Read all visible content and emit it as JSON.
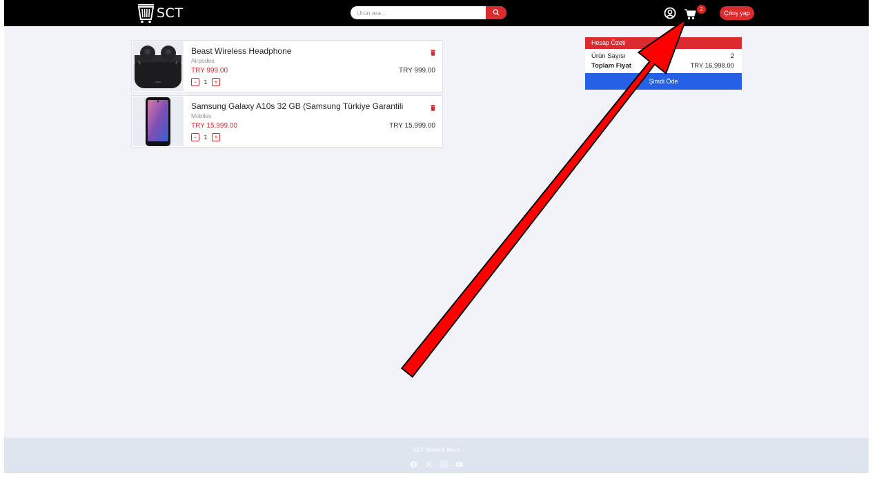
{
  "header": {
    "brand": "SCT",
    "search_placeholder": "Ürün ara...",
    "cart_count": "2",
    "logout_label": "Çıkış yap",
    "icons": {
      "logo": "basket-logo-icon",
      "search": "search-icon",
      "account": "user-circle-icon",
      "cart": "cart-icon"
    }
  },
  "cart": {
    "items": [
      {
        "title": "Beast Wireless Headphone",
        "category": "Airpodes",
        "price": "TRY 999.00",
        "total": "TRY 999.00",
        "quantity": "1",
        "minus": "-",
        "plus": "+"
      },
      {
        "title": "Samsung Galaxy A10s 32 GB (Samsung Türkiye Garantili",
        "category": "Mobiles",
        "price": "TRY 15,999.00",
        "total": "TRY 15,999.00",
        "quantity": "1",
        "minus": "-",
        "plus": "+"
      }
    ]
  },
  "summary": {
    "title": "Hesap Özeti",
    "count_label": "Ürün Sayısı",
    "count_value": "2",
    "total_label": "Toplam Fiyat",
    "total_value": "TRY 16,998.00",
    "pay_label": "Şimdi Öde"
  },
  "footer": {
    "title": "SCT Store & More",
    "socials": [
      "facebook-icon",
      "x-icon",
      "instagram-icon",
      "youtube-icon"
    ]
  },
  "colors": {
    "accent": "#dc2b2f",
    "primary_button": "#2461e6",
    "navbar": "#000000",
    "page_background": "#f1f3f8",
    "annotation_arrow": "#ff0000"
  }
}
